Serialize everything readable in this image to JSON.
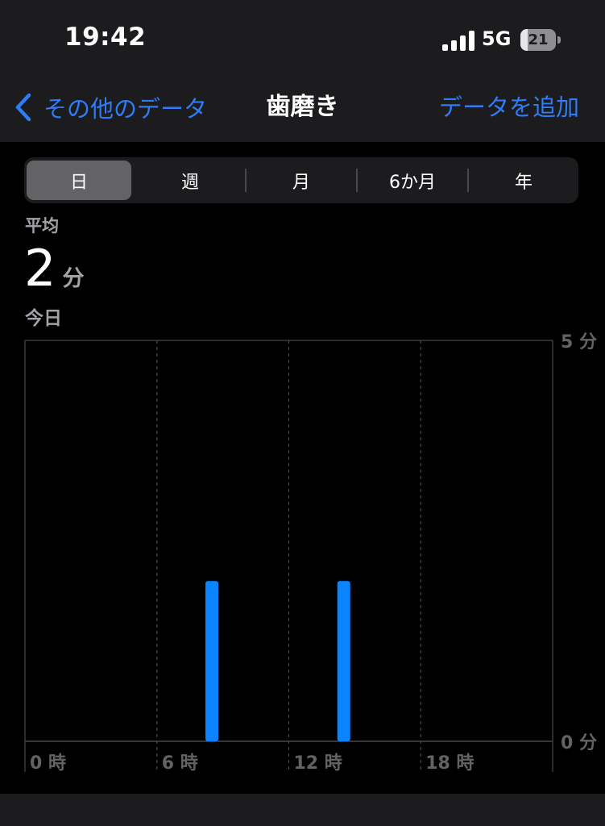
{
  "status_bar": {
    "time": "19:42",
    "network": "5G",
    "battery_level": "21",
    "battery_fraction": 0.21,
    "signal_bars": 4
  },
  "nav": {
    "back_label": "その他のデータ",
    "title": "歯磨き",
    "add_label": "データを追加"
  },
  "segments": {
    "items": [
      "日",
      "週",
      "月",
      "6か月",
      "年"
    ],
    "selected": "日"
  },
  "summary": {
    "avg_label": "平均",
    "avg_value": "2",
    "avg_unit": "分",
    "date_label": "今日"
  },
  "colors": {
    "accent": "#2f7cf6",
    "bar": "#0a84ff",
    "background": "#000000",
    "surface": "#1c1c1e",
    "secondary_text": "#a1a1a6"
  },
  "chart_data": {
    "type": "bar",
    "x": [
      8.5,
      14.5
    ],
    "values": [
      2,
      2
    ],
    "xlim": [
      0,
      24
    ],
    "ylim": [
      0,
      5
    ],
    "x_ticks": [
      0,
      6,
      12,
      18
    ],
    "x_tick_labels": [
      "0 時",
      "6 時",
      "12 時",
      "18 時"
    ],
    "y_ticks": [
      5,
      0
    ],
    "y_tick_labels": [
      "5 分",
      "0 分"
    ],
    "grid": true
  }
}
